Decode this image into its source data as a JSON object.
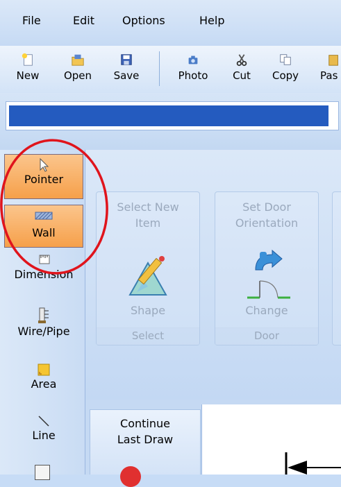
{
  "menu": [
    "File",
    "Edit",
    "Options",
    "Help"
  ],
  "toolbar": {
    "new": "New",
    "open": "Open",
    "save": "Save",
    "photo": "Photo",
    "cut": "Cut",
    "copy": "Copy",
    "paste": "Pas"
  },
  "tools": [
    {
      "label": "Pointer",
      "icon": "pointer-icon",
      "active": true
    },
    {
      "label": "Wall",
      "icon": "wall-icon",
      "active": true
    },
    {
      "label": "Dimension",
      "icon": "dimension-icon",
      "active": false
    },
    {
      "label": "Wire/Pipe",
      "icon": "wire-pipe-icon",
      "active": false
    },
    {
      "label": "Area",
      "icon": "area-icon",
      "active": false
    },
    {
      "label": "Line",
      "icon": "line-icon",
      "active": false
    }
  ],
  "ribbon": {
    "select_group": {
      "title_line1": "Select New",
      "title_line2": "Item",
      "button": "Shape",
      "footer": "Select"
    },
    "door_group": {
      "title_line1": "Set Door",
      "title_line2": "Orientation",
      "button": "Change",
      "footer": "Door"
    }
  },
  "continue_panel": {
    "line1": "Continue",
    "line2": "Last Draw"
  },
  "colors": {
    "accent_blue": "#245bbf",
    "active_tool": "#f6a04a",
    "annotation": "#e0141c"
  }
}
